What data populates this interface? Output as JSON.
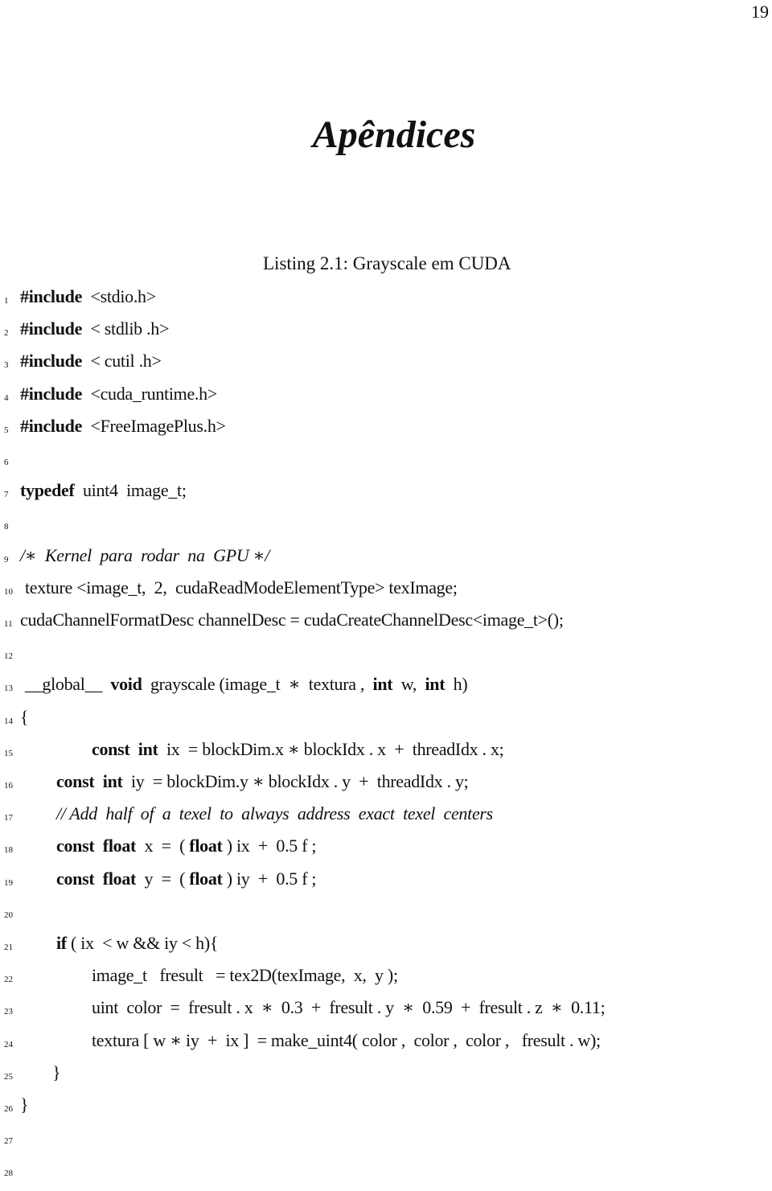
{
  "page": {
    "number": "19",
    "chapter_title": "Apêndices",
    "listing_caption": "Listing 2.1: Grayscale em CUDA"
  },
  "listing": {
    "lines": [
      {
        "n": "1",
        "indent": 0,
        "parts": [
          {
            "t": "#include",
            "s": "kw"
          },
          {
            "t": "  <stdio.h>"
          }
        ]
      },
      {
        "n": "2",
        "indent": 0,
        "parts": [
          {
            "t": "#include",
            "s": "kw"
          },
          {
            "t": "  < stdlib .h>"
          }
        ]
      },
      {
        "n": "3",
        "indent": 0,
        "parts": [
          {
            "t": "#include",
            "s": "kw"
          },
          {
            "t": "  < cutil .h>"
          }
        ]
      },
      {
        "n": "4",
        "indent": 0,
        "parts": [
          {
            "t": "#include",
            "s": "kw"
          },
          {
            "t": "  <cuda_runtime.h>"
          }
        ]
      },
      {
        "n": "5",
        "indent": 0,
        "parts": [
          {
            "t": "#include",
            "s": "kw"
          },
          {
            "t": "  <FreeImagePlus.h>"
          }
        ]
      },
      {
        "n": "6",
        "indent": 0,
        "parts": []
      },
      {
        "n": "7",
        "indent": 0,
        "parts": [
          {
            "t": "typedef",
            "s": "kw"
          },
          {
            "t": "  uint4  image_t;"
          }
        ]
      },
      {
        "n": "8",
        "indent": 0,
        "parts": []
      },
      {
        "n": "9",
        "indent": 0,
        "parts": [
          {
            "t": "/∗  Kernel  para  rodar  na  GPU ∗/",
            "s": "cm"
          }
        ]
      },
      {
        "n": "10",
        "indent": 1,
        "parts": [
          {
            "t": "texture <image_t,  2,  cudaReadModeElementType> texImage;"
          }
        ]
      },
      {
        "n": "11",
        "indent": 0,
        "parts": [
          {
            "t": "cudaChannelFormatDesc channelDesc = cudaCreateChannelDesc<image_t>();"
          }
        ]
      },
      {
        "n": "12",
        "indent": 0,
        "parts": []
      },
      {
        "n": "13",
        "indent": 1,
        "parts": [
          {
            "t": "__global__  "
          },
          {
            "t": "void",
            "s": "kw"
          },
          {
            "t": "  grayscale (image_t  ∗  textura ,  "
          },
          {
            "t": "int",
            "s": "kw"
          },
          {
            "t": "  w,  "
          },
          {
            "t": "int",
            "s": "kw"
          },
          {
            "t": "  h)"
          }
        ]
      },
      {
        "n": "14",
        "indent": 0,
        "parts": [
          {
            "t": "{"
          }
        ]
      },
      {
        "n": "15",
        "indent": 4,
        "parts": [
          {
            "t": "const",
            "s": "kw"
          },
          {
            "t": "  "
          },
          {
            "t": "int",
            "s": "kw"
          },
          {
            "t": "  ix  = blockDim.x ∗ blockIdx . x  +  threadIdx . x;"
          }
        ]
      },
      {
        "n": "16",
        "indent": 2,
        "parts": [
          {
            "t": "const",
            "s": "kw"
          },
          {
            "t": "  "
          },
          {
            "t": "int",
            "s": "kw"
          },
          {
            "t": "  iy  = blockDim.y ∗ blockIdx . y  +  threadIdx . y;"
          }
        ]
      },
      {
        "n": "17",
        "indent": 2,
        "parts": [
          {
            "t": "// Add  half  of  a  texel  to  always  address  exact  texel  centers",
            "s": "cm"
          }
        ]
      },
      {
        "n": "18",
        "indent": 2,
        "parts": [
          {
            "t": "const",
            "s": "kw"
          },
          {
            "t": "  "
          },
          {
            "t": "float",
            "s": "kw"
          },
          {
            "t": "  x  =  ( "
          },
          {
            "t": "float",
            "s": "kw"
          },
          {
            "t": " ) ix  +  0.5 f ;"
          }
        ]
      },
      {
        "n": "19",
        "indent": 2,
        "parts": [
          {
            "t": "const",
            "s": "kw"
          },
          {
            "t": "  "
          },
          {
            "t": "float",
            "s": "kw"
          },
          {
            "t": "  y  =  ( "
          },
          {
            "t": "float",
            "s": "kw"
          },
          {
            "t": " ) iy  +  0.5 f ;"
          }
        ]
      },
      {
        "n": "20",
        "indent": 0,
        "parts": []
      },
      {
        "n": "21",
        "indent": 2,
        "parts": [
          {
            "t": "if",
            "s": "kw"
          },
          {
            "t": " ( ix  < w && iy < h){"
          }
        ]
      },
      {
        "n": "22",
        "indent": 4,
        "parts": [
          {
            "t": "image_t   fresult   = tex2D(texImage,  x,  y );"
          }
        ]
      },
      {
        "n": "23",
        "indent": 4,
        "parts": [
          {
            "t": "uint  color  =  fresult . x  ∗  0.3  +  fresult . y  ∗  0.59  +  fresult . z  ∗  0.11;"
          }
        ]
      },
      {
        "n": "24",
        "indent": 4,
        "parts": [
          {
            "t": "textura [ w ∗ iy  +  ix ]  = make_uint4( color ,  color ,  color ,   fresult . w);"
          }
        ]
      },
      {
        "n": "25",
        "indent": 3,
        "parts": [
          {
            "t": "}"
          }
        ]
      },
      {
        "n": "26",
        "indent": 0,
        "parts": [
          {
            "t": "}"
          }
        ]
      },
      {
        "n": "27",
        "indent": 0,
        "parts": []
      },
      {
        "n": "28",
        "indent": 0,
        "parts": []
      }
    ]
  }
}
